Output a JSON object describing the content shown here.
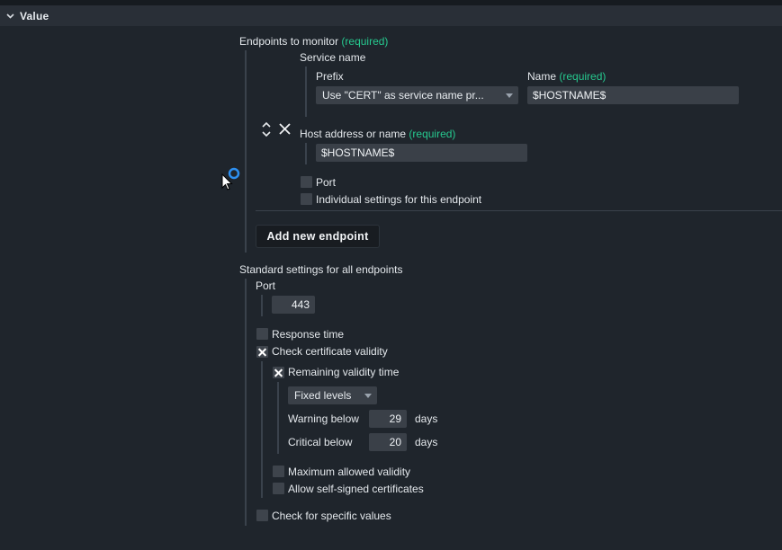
{
  "section": {
    "title": "Value"
  },
  "endpoints": {
    "label": "Endpoints to monitor",
    "required": "(required)",
    "service_name": {
      "label": "Service name",
      "prefix_label": "Prefix",
      "prefix_value": "Use \"CERT\" as service name pr...",
      "name_label": "Name",
      "name_required": "(required)",
      "name_value": "$HOSTNAME$"
    },
    "host": {
      "label": "Host address or name",
      "required": "(required)",
      "value": "$HOSTNAME$"
    },
    "port_label": "Port",
    "individual_label": "Individual settings for this endpoint",
    "add_button": "Add new endpoint"
  },
  "standard": {
    "label": "Standard settings for all endpoints",
    "port_label": "Port",
    "port_value": "443",
    "response_time": "Response time",
    "check_cert": "Check certificate validity",
    "remaining": "Remaining validity time",
    "levels_select": "Fixed levels",
    "warning_label": "Warning below",
    "warning_value": "29",
    "critical_label": "Critical below",
    "critical_value": "20",
    "days": "days",
    "max_validity": "Maximum allowed validity",
    "self_signed": "Allow self-signed certificates",
    "specific_values": "Check for specific values"
  }
}
